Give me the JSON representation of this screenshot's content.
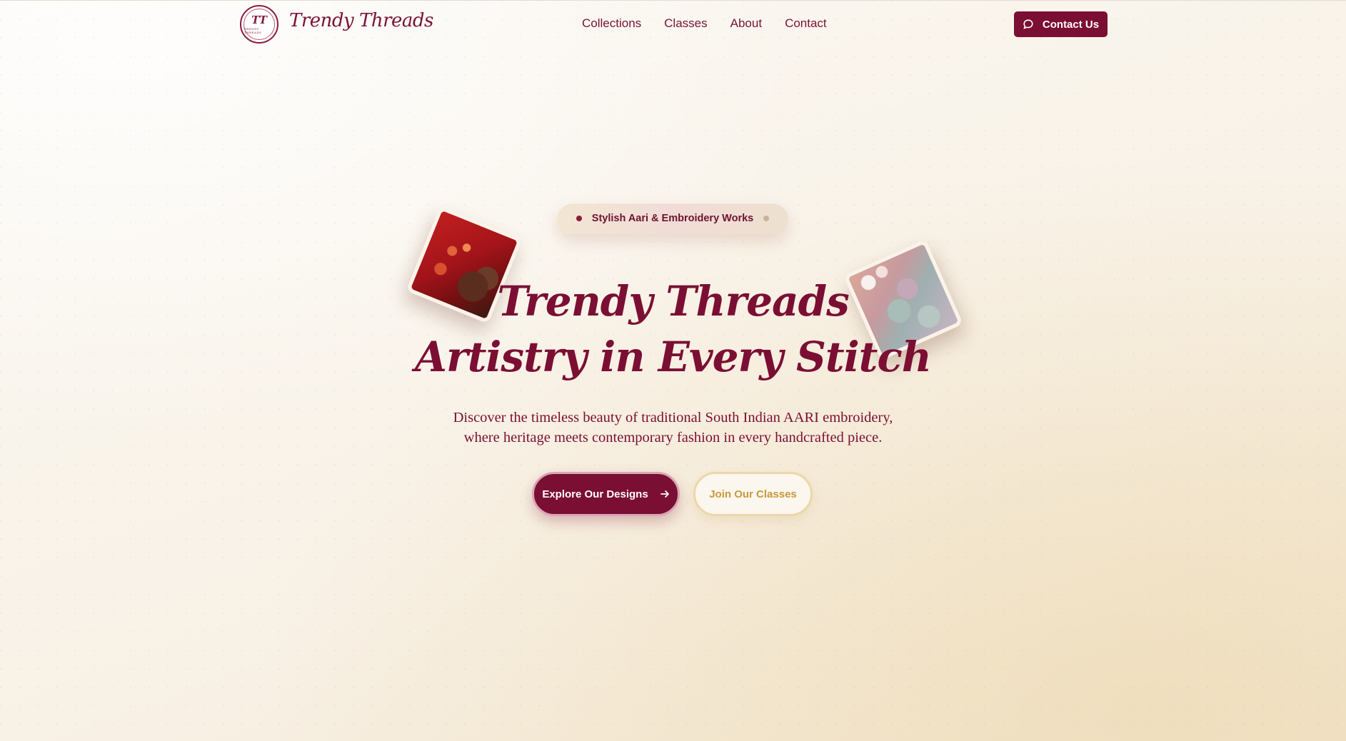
{
  "brand": {
    "name": "Trendy Threads",
    "logo_monogram": "TT",
    "logo_tagline": "TRENDY THREADS"
  },
  "nav": {
    "links": [
      "Collections",
      "Classes",
      "About",
      "Contact"
    ],
    "cta_label": "Contact Us"
  },
  "hero": {
    "badge": "Stylish Aari & Embroidery Works",
    "title_line1": "Trendy Threads",
    "title_line2": "Artistry in Every Stitch",
    "description_line1": "Discover the timeless beauty of traditional South Indian AARI embroidery,",
    "description_line2": "where heritage meets contemporary fashion in every handcrafted piece.",
    "primary_button": "Explore Our Designs",
    "secondary_button": "Join Our Classes"
  },
  "colors": {
    "brand_maroon": "#7b0f33",
    "gold": "#c99a3a",
    "background": "#faf6f0"
  },
  "icons": {
    "nav_cta": "chat-bubble-icon",
    "primary_button": "arrow-right-icon"
  }
}
